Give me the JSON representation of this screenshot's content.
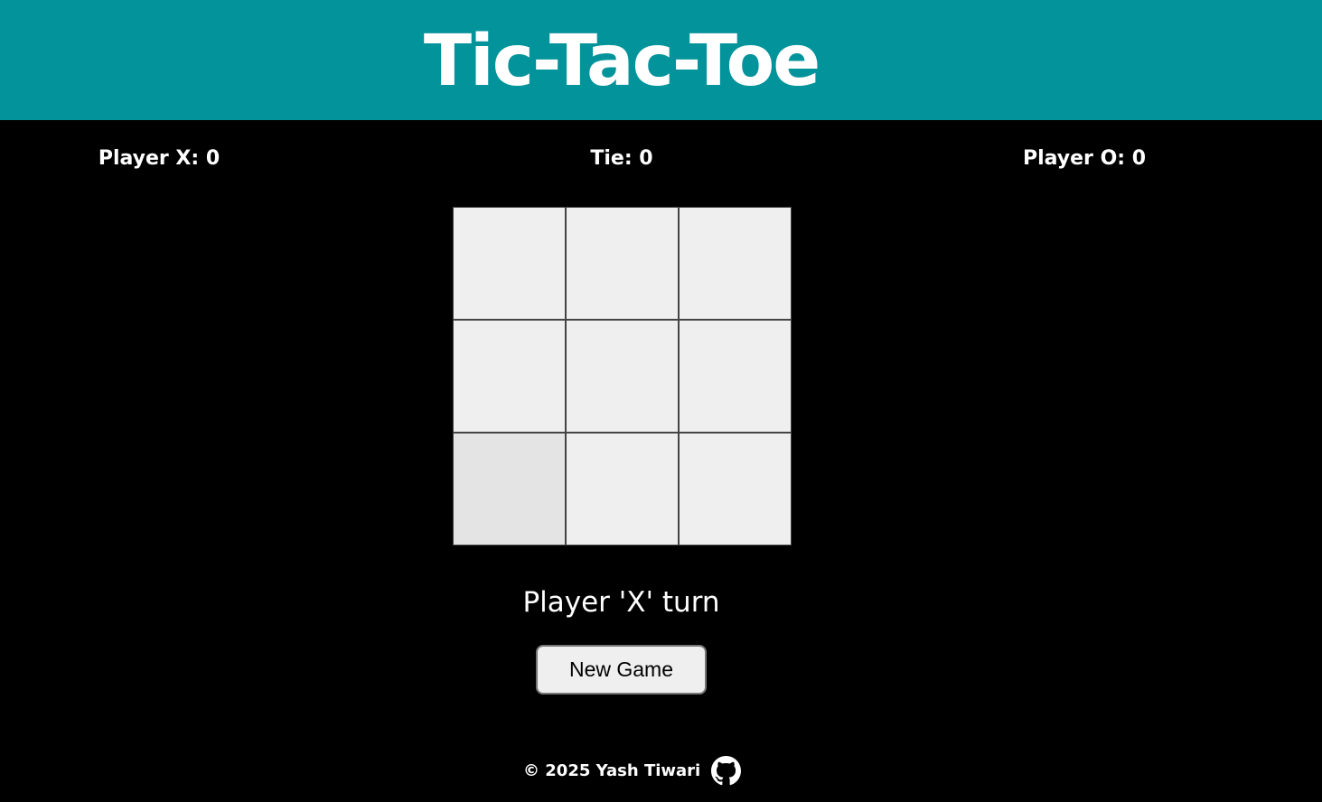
{
  "header": {
    "title": "Tic-Tac-Toe",
    "background_color": "#03939b"
  },
  "scores": {
    "player_x": "Player X: 0",
    "tie": "Tie: 0",
    "player_o": "Player O: 0"
  },
  "board": {
    "cells": [
      "",
      "",
      "",
      "",
      "",
      "",
      "",
      "",
      ""
    ],
    "cell_color": "#efefef",
    "hovered_cell_index": 6
  },
  "status": {
    "turn_text": "Player 'X' turn"
  },
  "controls": {
    "new_game_label": "New Game"
  },
  "footer": {
    "copyright": "© 2025 Yash Tiwari",
    "icon": "github-icon"
  }
}
